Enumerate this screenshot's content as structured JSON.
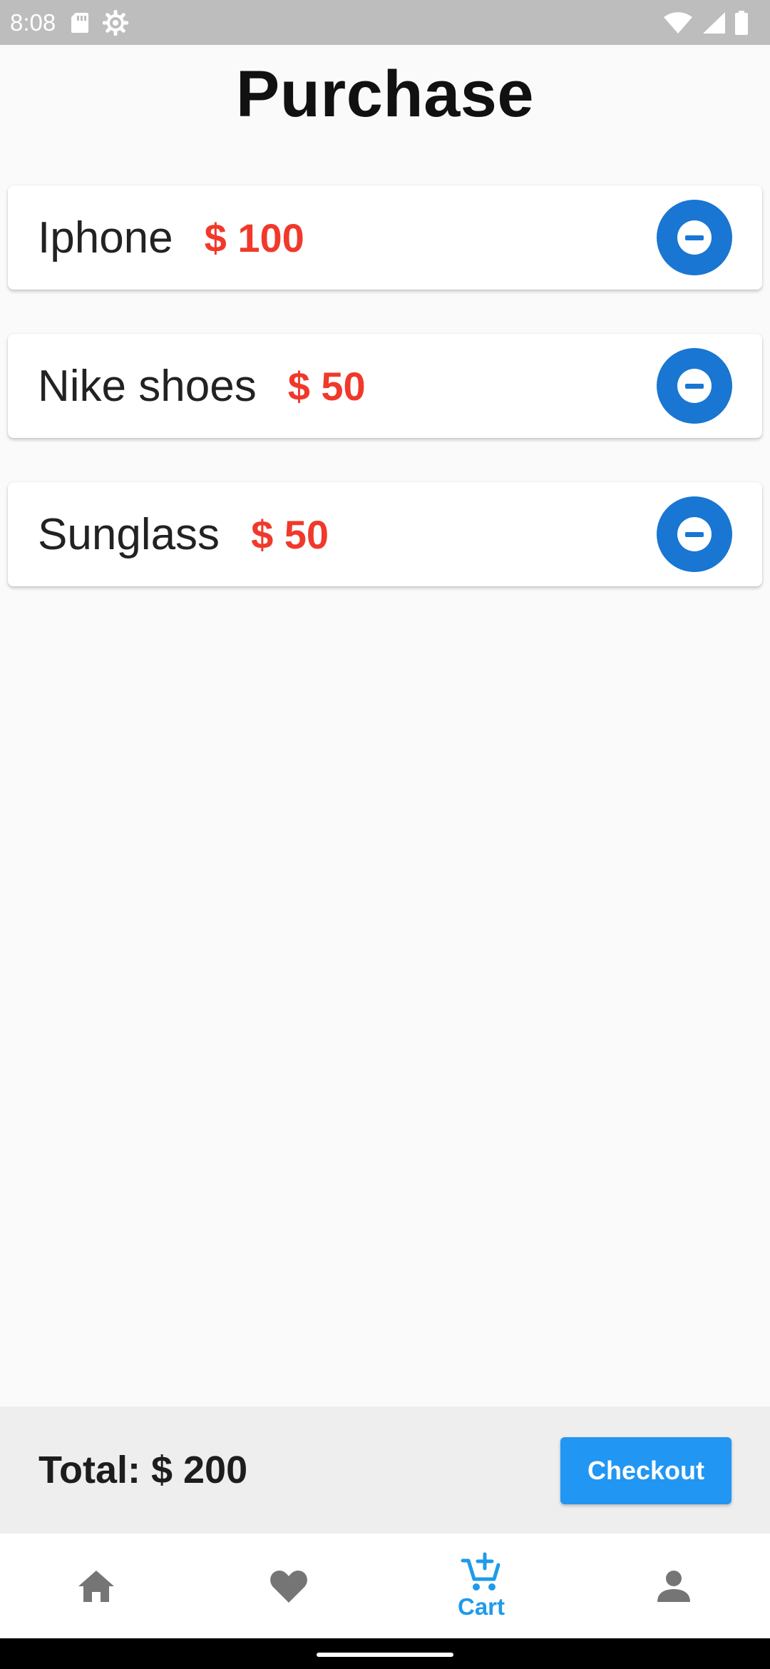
{
  "status_bar": {
    "time": "8:08",
    "icons": [
      "sd-card-icon",
      "settings-gear-icon",
      "wifi-icon",
      "signal-icon",
      "battery-icon"
    ]
  },
  "header": {
    "title": "Purchase"
  },
  "cart": {
    "items": [
      {
        "name": "Iphone",
        "price": "$ 100"
      },
      {
        "name": "Nike shoes",
        "price": "$ 50"
      },
      {
        "name": "Sunglass",
        "price": "$ 50"
      }
    ]
  },
  "checkout": {
    "total": "Total: $ 200",
    "button_label": "Checkout"
  },
  "bottom_nav": {
    "items": [
      {
        "icon": "home-icon",
        "label": ""
      },
      {
        "icon": "heart-icon",
        "label": ""
      },
      {
        "icon": "add-shopping-cart-icon",
        "label": "Cart"
      },
      {
        "icon": "person-icon",
        "label": ""
      }
    ],
    "active_index": 2
  },
  "colors": {
    "accent": "#1976d2",
    "price": "#f0392b",
    "checkout_button": "#2196f3",
    "nav_active": "#1e9be9",
    "nav_inactive": "#757575"
  }
}
